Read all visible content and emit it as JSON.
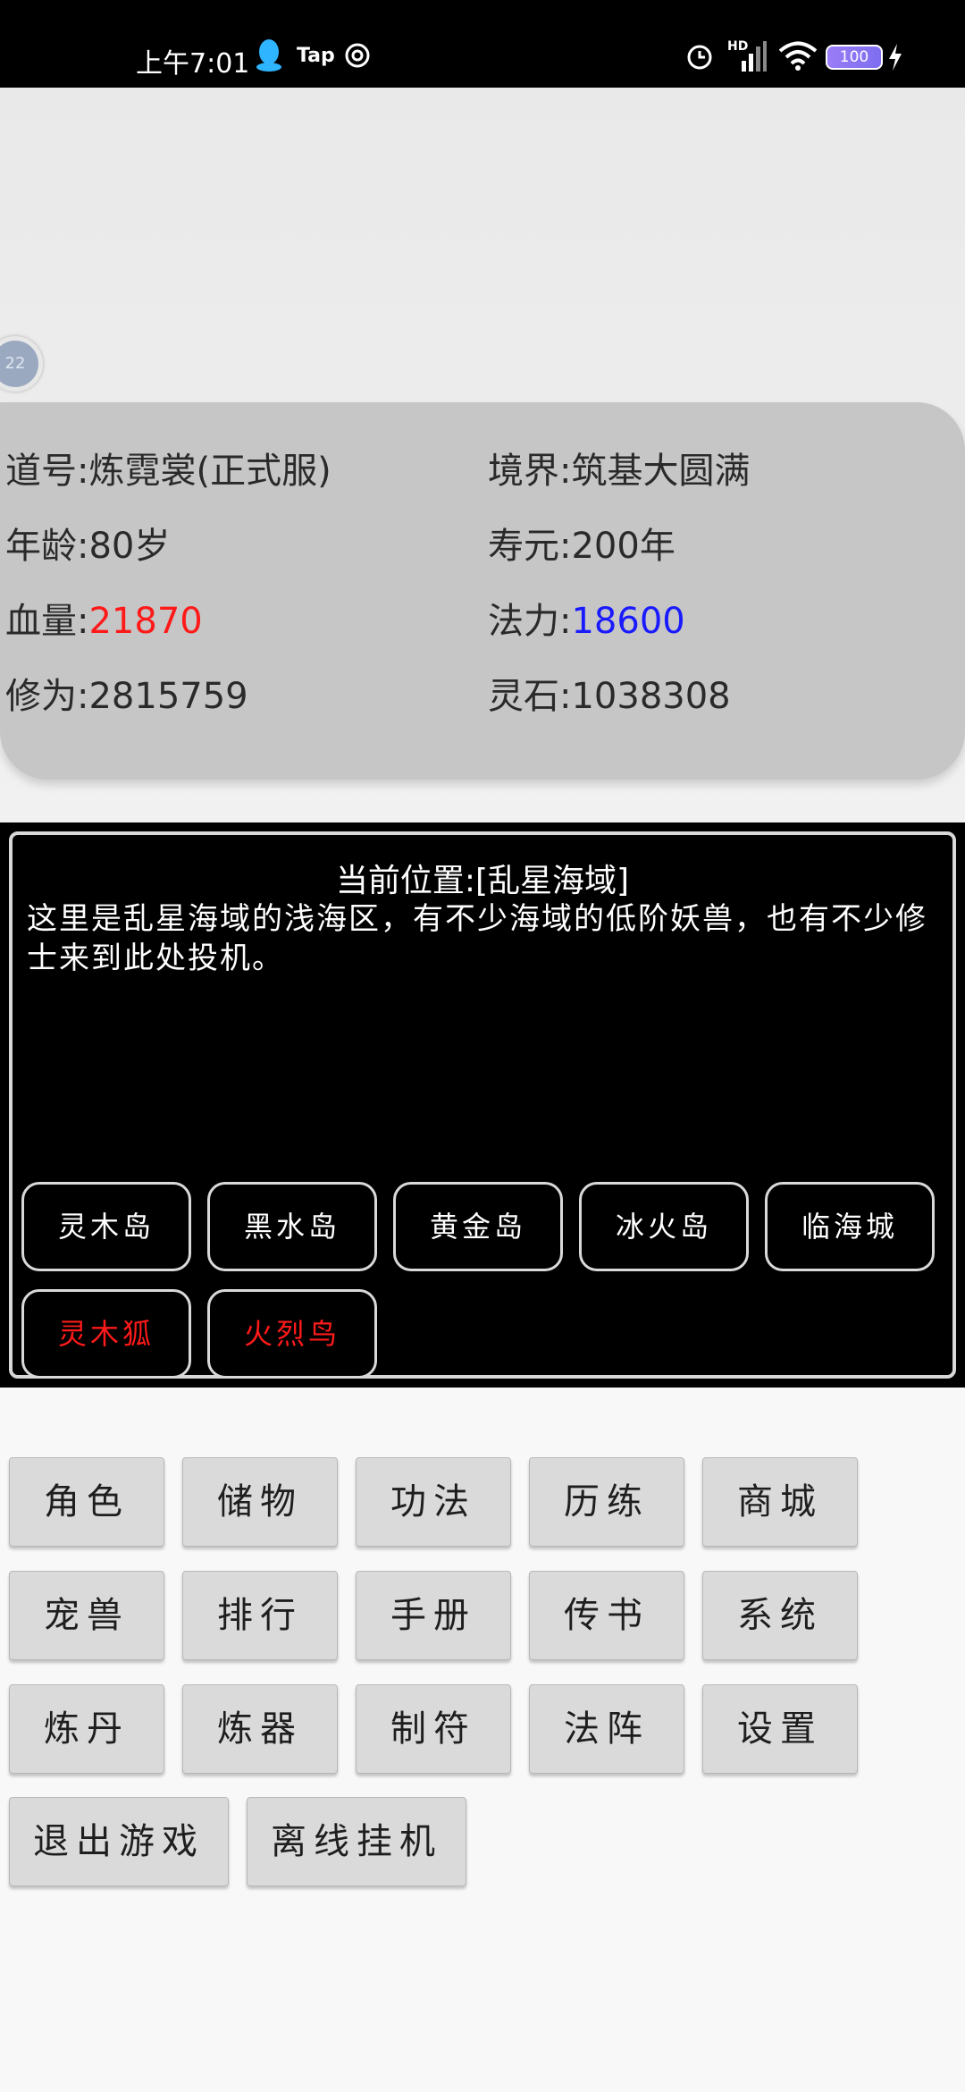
{
  "status_bar": {
    "time": "上午7:01",
    "tap_label": "Tap",
    "hd_label": "HD",
    "battery": "100",
    "icons": [
      "qq-icon",
      "tap-icon",
      "spiral-icon",
      "alarm-icon",
      "signal-icon",
      "wifi-icon",
      "battery-icon",
      "charging-icon"
    ]
  },
  "float_ball": {
    "label": "22"
  },
  "stats": {
    "name_label": "道号:",
    "name_value": "炼霓裳(正式服)",
    "realm_label": "境界:",
    "realm_value": "筑基大圆满",
    "age_label": "年龄:",
    "age_value": "80岁",
    "lifespan_label": "寿元:",
    "lifespan_value": "200年",
    "hp_label": "血量:",
    "hp_value": "21870",
    "mana_label": "法力:",
    "mana_value": "18600",
    "cultivation_label": "修为:",
    "cultivation_value": "2815759",
    "spirit_stone_label": "灵石:",
    "spirit_stone_value": "1038308"
  },
  "location": {
    "title": "当前位置:[乱星海域]",
    "description": "这里是乱星海域的浅海区，有不少海域的低阶妖兽，也有不少修士来到此处投机。",
    "destinations": [
      "灵木岛",
      "黑水岛",
      "黄金岛",
      "冰火岛",
      "临海城"
    ],
    "enemies": [
      "灵木狐",
      "火烈鸟"
    ]
  },
  "menu": {
    "row1": [
      "角色",
      "储物",
      "功法",
      "历练",
      "商城"
    ],
    "row2": [
      "宠兽",
      "排行",
      "手册",
      "传书",
      "系统"
    ],
    "row3": [
      "炼丹",
      "炼器",
      "制符",
      "法阵",
      "设置"
    ],
    "row4": [
      "退出游戏",
      "离线挂机"
    ]
  },
  "colors": {
    "hp": "#ff1a1a",
    "mana": "#1a1aff",
    "enemy": "#ff1a1a"
  }
}
